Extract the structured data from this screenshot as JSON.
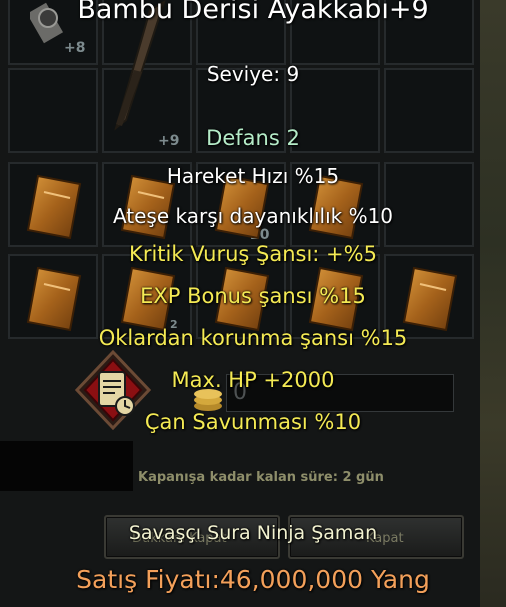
{
  "item": {
    "name": "Bambu Derisi Ayakkabı+9",
    "level": "Seviye: 9",
    "defense": "Defans 2",
    "bonuses_white": [
      "Hareket Hızı %15",
      "Ateşe karşı dayanıklılık %10"
    ],
    "bonuses_yellow": [
      "Kritik Vuruş Şansı: +%5",
      "EXP Bonus şansı %15",
      "Oklardan korunma şansı %15",
      "Max. HP +2000",
      "Çan Savunması %10"
    ],
    "classes": "Savaşçı Sura Ninja Şaman",
    "price": "Satış Fiyatı:46,000,000 Yang"
  },
  "inventory": {
    "counts": {
      "slot_1": "+8",
      "slot_2": "+9",
      "stack": "20",
      "stack_small": "2"
    }
  },
  "shop": {
    "input_value": "0",
    "remaining_time": "Kapanışa kadar kalan süre: 2 gün",
    "button_left_label": "Dükkânı Kapat",
    "button_right_label": "Kapat"
  },
  "colors": {
    "title": "#ffffff",
    "defense": "#b5ecc8",
    "bonus_yellow": "#f4ea54",
    "price": "#f3a05a"
  },
  "icons": [
    "sword-icon",
    "book-icon",
    "scroll-clock-icon",
    "gold-coins-icon"
  ]
}
